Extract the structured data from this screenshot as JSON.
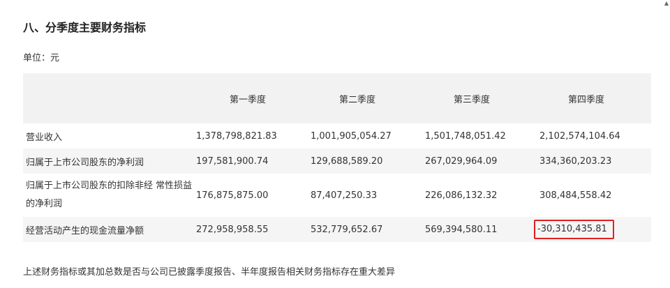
{
  "section": {
    "title": "八、分季度主要财务指标",
    "unit": "单位：元"
  },
  "table": {
    "headers": [
      "",
      "第一季度",
      "第二季度",
      "第三季度",
      "第四季度"
    ],
    "rows": [
      {
        "label": "营业收入",
        "values": [
          "1,378,798,821.83",
          "1,001,905,054.27",
          "1,501,748,051.42",
          "2,102,574,104.64"
        ]
      },
      {
        "label": "归属于上市公司股东的净利润",
        "values": [
          "197,581,900.74",
          "129,688,589.20",
          "267,029,964.09",
          "334,360,203.23"
        ]
      },
      {
        "label": "归属于上市公司股东的扣除非经 常性损益的净利润",
        "values": [
          "176,875,875.00",
          "87,407,250.33",
          "226,086,132.32",
          "308,484,558.42"
        ]
      },
      {
        "label": "经营活动产生的现金流量净额",
        "values": [
          "272,958,958.55",
          "532,779,652.67",
          "569,394,580.11",
          "-30,310,435.81"
        ]
      }
    ]
  },
  "footnote": "上述财务指标或其加总数是否与公司已披露季度报告、半年度报告相关财务指标存在重大差异",
  "colors": {
    "highlight_border": "#e02020",
    "header_bg": "#f2f2f2",
    "stripe_bg": "#f5f5f5"
  }
}
